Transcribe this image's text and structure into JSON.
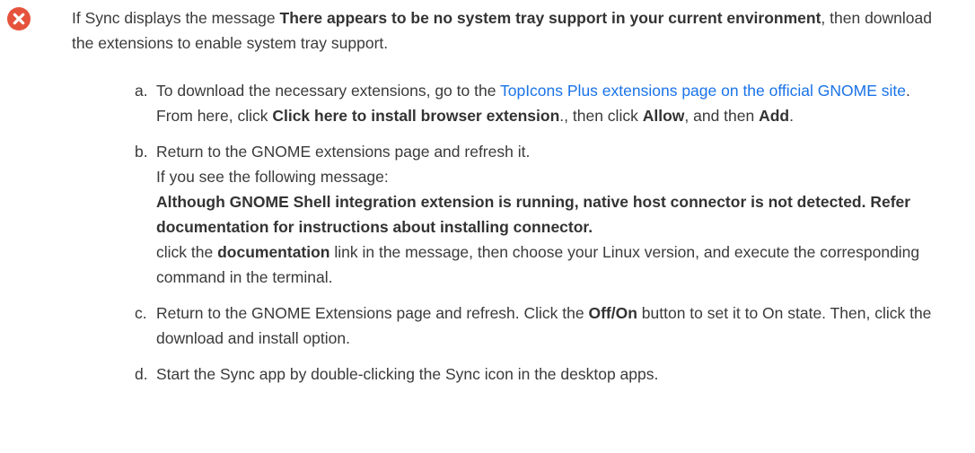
{
  "icon": {
    "name": "error-icon",
    "color": "#e5533d"
  },
  "intro": {
    "before": "If Sync displays the message ",
    "bold": "There appears to be no system tray support in your current environment",
    "after": ", then download the extensions to enable system tray support."
  },
  "steps": [
    {
      "marker": "a.",
      "t1": "To download the necessary extensions, go to the ",
      "link": "TopIcons Plus extensions page on the official GNOME site",
      "t2": ". From here, click ",
      "b1": "Click here to install browser extension",
      "t3": "., then click ",
      "b2": "Allow",
      "t4": ", and then ",
      "b3": "Add",
      "t5": "."
    },
    {
      "marker": "b.",
      "line1": "Return to the GNOME extensions page and refresh it.",
      "line2": "If you see the following message:",
      "bold_message": "Although GNOME Shell integration extension is running, native host connector is not detected. Refer documentation for instructions about installing connector.",
      "t1": "click the ",
      "b1": "documentation",
      "t2": " link in the message, then choose your Linux version, and execute the corresponding command in the terminal."
    },
    {
      "marker": "c.",
      "t1": "Return to the GNOME Extensions page and refresh. Click the ",
      "b1": "Off/On",
      "t2": " button to set it to On state. Then, click the download and install option."
    },
    {
      "marker": "d.",
      "t1": "Start the Sync app by double-clicking the Sync icon in the desktop apps."
    }
  ]
}
